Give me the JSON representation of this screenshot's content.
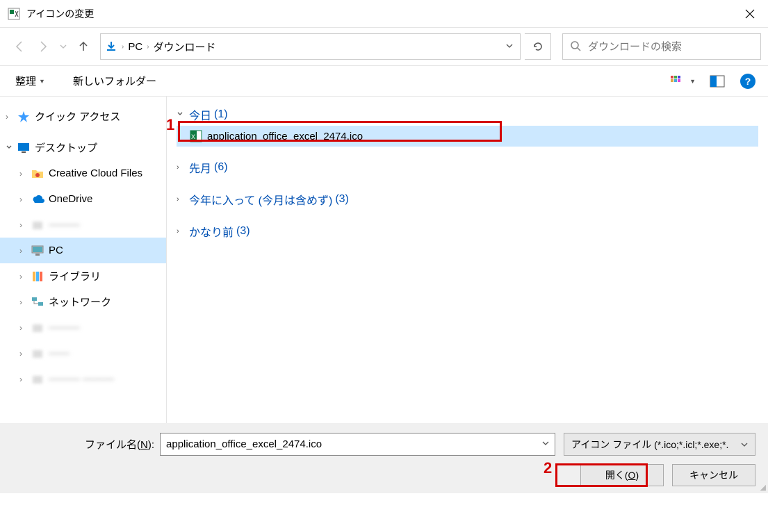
{
  "title": "アイコンの変更",
  "breadcrumb": {
    "root": "PC",
    "folder": "ダウンロード"
  },
  "search": {
    "placeholder": "ダウンロードの検索"
  },
  "toolbar": {
    "organize": "整理",
    "newfolder": "新しいフォルダー"
  },
  "sidebar": {
    "quick": "クイック アクセス",
    "desktop": "デスクトップ",
    "ccf": "Creative Cloud Files",
    "onedrive": "OneDrive",
    "hidden1": "———",
    "pc": "PC",
    "library": "ライブラリ",
    "network": "ネットワーク",
    "hidden2": "———",
    "hidden3": "——",
    "hidden4": "——— ———"
  },
  "groups": {
    "today": {
      "label": "今日",
      "count": "(1)"
    },
    "lastmonth": {
      "label": "先月",
      "count": "(6)"
    },
    "thisyear": {
      "label": "今年に入って (今月は含めず)",
      "count": "(3)"
    },
    "longago": {
      "label": "かなり前",
      "count": "(3)"
    }
  },
  "file": {
    "name": "application_office_excel_2474.ico"
  },
  "footer": {
    "fn_label_pre": "ファイル名(",
    "fn_label_u": "N",
    "fn_label_post": "):",
    "fn_value": "application_office_excel_2474.ico",
    "filter": "アイコン ファイル (*.ico;*.icl;*.exe;*.",
    "open_pre": "開く(",
    "open_u": "O",
    "open_post": ")",
    "cancel": "キャンセル"
  },
  "annotations": {
    "one": "1",
    "two": "2"
  }
}
